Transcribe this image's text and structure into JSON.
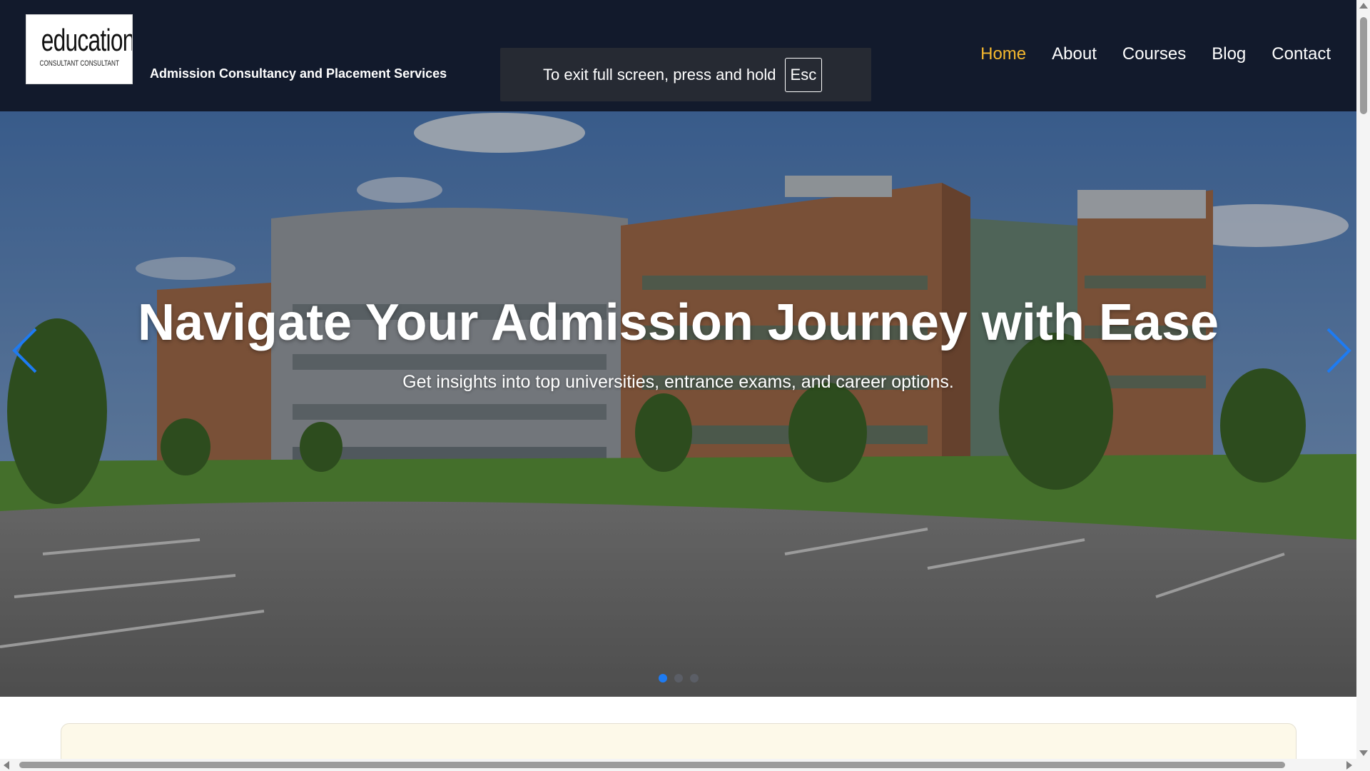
{
  "brand": {
    "logo_word": "education",
    "logo_sub": "CONSULTANT CONSULTANT",
    "tagline": "Admission Consultancy and Placement Services"
  },
  "nav": {
    "items": [
      {
        "label": "Home",
        "active": true
      },
      {
        "label": "About"
      },
      {
        "label": "Courses"
      },
      {
        "label": "Blog"
      },
      {
        "label": "Contact"
      }
    ],
    "active_color": "#f5b82e"
  },
  "fullscreen_toast": {
    "text": "To exit full screen, press and hold",
    "key": "Esc"
  },
  "hero": {
    "title": "Navigate Your Admission Journey with Ease",
    "subtitle": "Get insights into top universities, entrance exams, and career options.",
    "slide_count": 3,
    "active_slide": 1,
    "prev_icon": "chevron-left-icon",
    "next_icon": "chevron-right-icon",
    "accent": "#1e7bf2"
  },
  "colors": {
    "header_bg": "#121a2c",
    "card_bg": "#fdf9e9"
  }
}
